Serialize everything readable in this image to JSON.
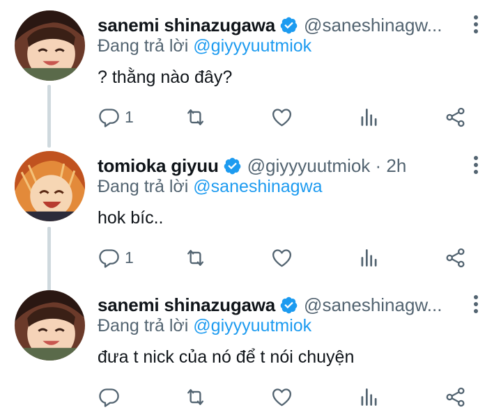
{
  "tweets": [
    {
      "name": "sanemi shinazugawa",
      "handle": "@saneshinagw...",
      "reply_prefix": "Đang trả lời",
      "reply_mention": "@giyyyuutmiok",
      "text": "? thằng nào đây?",
      "reply_count": "1"
    },
    {
      "name": "tomioka giyuu",
      "handle": "@giyyyuutmiok · 2h",
      "reply_prefix": "Đang trả lời",
      "reply_mention": "@saneshinagwa",
      "text": "hok bíc..",
      "reply_count": "1"
    },
    {
      "name": "sanemi shinazugawa",
      "handle": "@saneshinagw...",
      "reply_prefix": "Đang trả lời",
      "reply_mention": "@giyyyuutmiok",
      "text": "đưa t nick của nó để t nói chuyện",
      "reply_count": ""
    }
  ],
  "colors": {
    "accent": "#1d9bf0",
    "secondary_text": "#536471",
    "thread_line": "#cfd9de"
  },
  "icons": [
    "verified-badge-icon",
    "more-vertical-icon",
    "reply-icon",
    "retweet-icon",
    "like-icon",
    "analytics-icon",
    "share-icon"
  ]
}
